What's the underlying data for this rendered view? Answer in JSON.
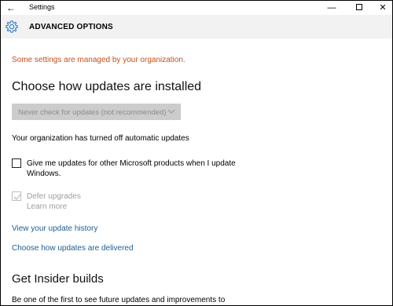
{
  "window": {
    "title": "Settings",
    "back_glyph": "←",
    "minimize_glyph": "—",
    "close_glyph": "✕"
  },
  "header": {
    "icon": "gear-icon",
    "title": "ADVANCED OPTIONS"
  },
  "content": {
    "managed_notice": "Some settings are managed by your organization.",
    "install_heading": "Choose how updates are installed",
    "install_dropdown": {
      "selected": "Never check for updates (not recommended)",
      "disabled": true
    },
    "org_status": "Your organization has turned off automatic updates",
    "microsoft_products_checkbox": {
      "label": "Give me updates for other Microsoft products when I update Windows.",
      "checked": false
    },
    "defer_upgrades_checkbox": {
      "label": "Defer upgrades",
      "checked": true,
      "disabled": true
    },
    "learn_more": "Learn more",
    "update_history_link": "View your update history",
    "delivery_link": "Choose how updates are delivered",
    "insider_heading": "Get Insider builds",
    "insider_text": "Be one of the first to see future updates and improvements to"
  },
  "colors": {
    "notice": "#c4501b",
    "link": "#1d5d92",
    "accent": "#2a78c2",
    "disabled_text": "#9e9e9e",
    "header_bg": "#f2f2f2"
  }
}
